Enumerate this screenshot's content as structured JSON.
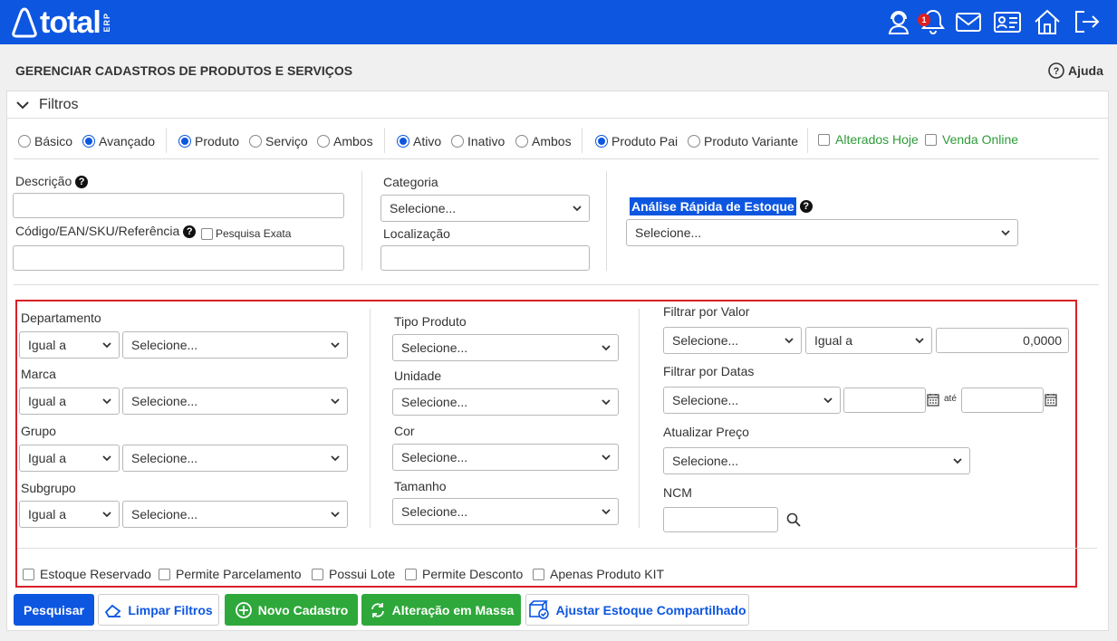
{
  "header": {
    "logo_text": "total",
    "logo_suffix": "ERP",
    "notification_count": "1"
  },
  "page": {
    "title": "GERENCIAR CADASTROS DE PRODUTOS E SERVIÇOS",
    "help_label": "Ajuda"
  },
  "filtros": {
    "title": "Filtros",
    "mode": {
      "basico": "Básico",
      "avancado": "Avançado"
    },
    "type": {
      "produto": "Produto",
      "servico": "Serviço",
      "ambos": "Ambos"
    },
    "status": {
      "ativo": "Ativo",
      "inativo": "Inativo",
      "ambos": "Ambos"
    },
    "variant": {
      "pai": "Produto Pai",
      "variante": "Produto Variante"
    },
    "alterados_hoje": "Alterados Hoje",
    "venda_online": "Venda Online"
  },
  "fields": {
    "descricao": "Descrição",
    "codigo": "Código/EAN/SKU/Referência",
    "pesquisa_exata": "Pesquisa Exata",
    "categoria": "Categoria",
    "categoria_value": "Selecione...",
    "localizacao": "Localização",
    "analise": "Análise Rápida de Estoque",
    "analise_value": "Selecione..."
  },
  "advanced": {
    "departamento": "Departamento",
    "marca": "Marca",
    "grupo": "Grupo",
    "subgrupo": "Subgrupo",
    "igual_a": "Igual a",
    "selecione": "Selecione...",
    "tipo_produto": "Tipo Produto",
    "unidade": "Unidade",
    "cor": "Cor",
    "tamanho": "Tamanho",
    "filtrar_valor": "Filtrar por Valor",
    "valor_value": "0,0000",
    "filtrar_datas": "Filtrar por Datas",
    "ate": "até",
    "atualizar_preco": "Atualizar Preço",
    "ncm": "NCM"
  },
  "checkboxes": [
    "Estoque Reservado",
    "Permite Parcelamento",
    "Possui Lote",
    "Permite Desconto",
    "Apenas Produto KIT"
  ],
  "buttons": {
    "pesquisar": "Pesquisar",
    "limpar": "Limpar Filtros",
    "novo": "Novo Cadastro",
    "alteracao": "Alteração em Massa",
    "ajustar": "Ajustar Estoque Compartilhado"
  },
  "colors": {
    "brand": "#0d56e0",
    "green": "#2ea83a",
    "highlight": "#d9202a"
  }
}
